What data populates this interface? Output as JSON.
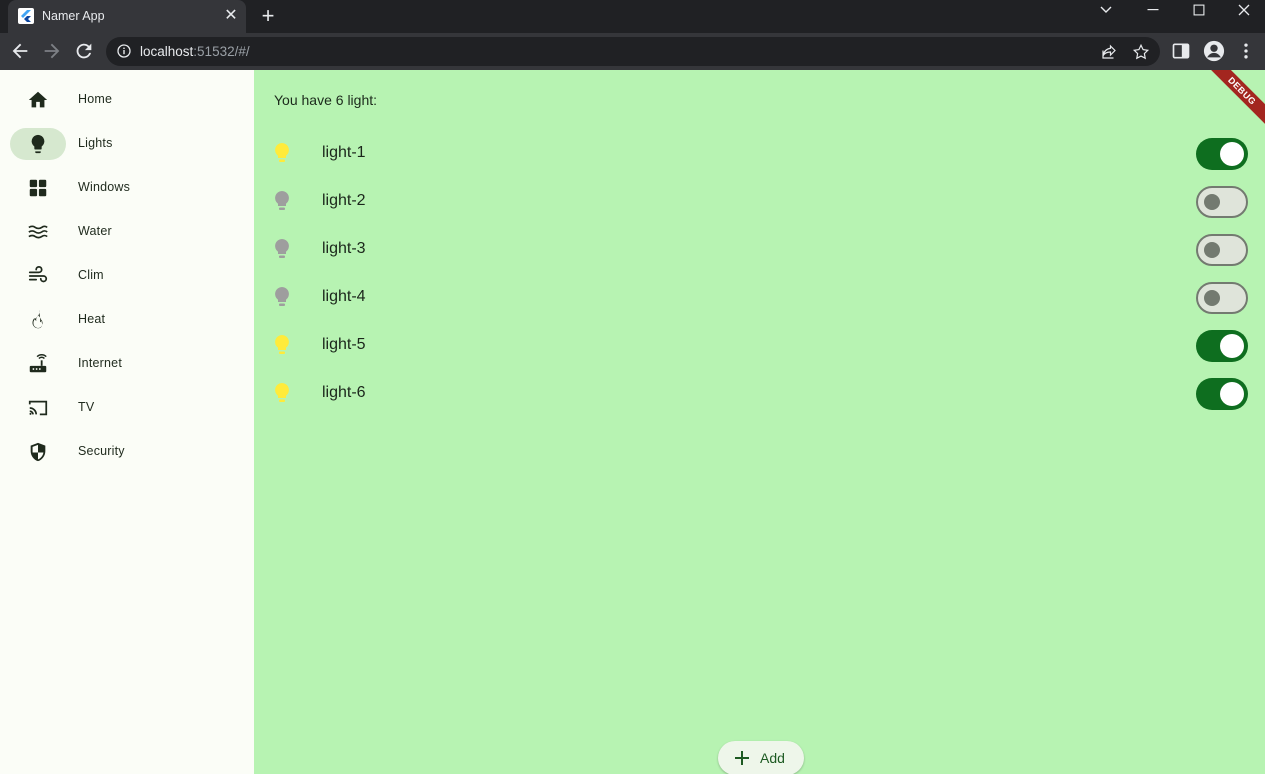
{
  "browser": {
    "tab_title": "Namer App",
    "tab_close": "✕",
    "new_tab": "+",
    "url_host": "localhost",
    "url_rest": ":51532/#/"
  },
  "rail": {
    "items": [
      {
        "label": "Home",
        "icon": "home-icon"
      },
      {
        "label": "Lights",
        "icon": "lightbulb-icon",
        "selected": true
      },
      {
        "label": "Windows",
        "icon": "windows-icon"
      },
      {
        "label": "Water",
        "icon": "water-icon"
      },
      {
        "label": "Clim",
        "icon": "wind-icon"
      },
      {
        "label": "Heat",
        "icon": "fire-icon"
      },
      {
        "label": "Internet",
        "icon": "router-icon"
      },
      {
        "label": "TV",
        "icon": "cast-icon"
      },
      {
        "label": "Security",
        "icon": "shield-icon"
      }
    ]
  },
  "main": {
    "count_text": "You have 6 light:",
    "lights": [
      {
        "name": "light-1",
        "on": true
      },
      {
        "name": "light-2",
        "on": false
      },
      {
        "name": "light-3",
        "on": false
      },
      {
        "name": "light-4",
        "on": false
      },
      {
        "name": "light-5",
        "on": true
      },
      {
        "name": "light-6",
        "on": true
      }
    ],
    "add_label": "Add",
    "debug_label": "DEBUG"
  },
  "colors": {
    "content_bg": "#b7f3b2",
    "rail_bg": "#fbfdf7",
    "switch_on": "#0e6e1f",
    "bulb_on": "#ffeb3b",
    "bulb_off": "#9e9e9e"
  }
}
